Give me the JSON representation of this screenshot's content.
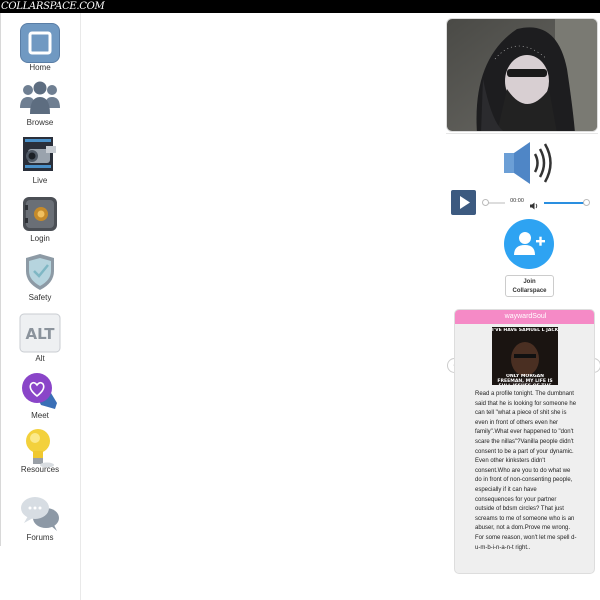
{
  "header": {
    "logo_text": "COLLARSPACE.COM"
  },
  "sidebar": {
    "items": [
      {
        "label": "Home",
        "icon": "home-icon"
      },
      {
        "label": "Browse",
        "icon": "people-icon"
      },
      {
        "label": "Live",
        "icon": "camcorder-icon"
      },
      {
        "label": "Login",
        "icon": "safe-lock-icon"
      },
      {
        "label": "Safety",
        "icon": "shield-icon"
      },
      {
        "label": "Alt",
        "icon": "alt-icon"
      },
      {
        "label": "Meet",
        "icon": "heart-chat-icon"
      },
      {
        "label": "Resources",
        "icon": "lightbulb-icon"
      },
      {
        "label": "Forums",
        "icon": "chat-bubbles-icon"
      }
    ]
  },
  "player": {
    "time": "00:00",
    "volume_percent": 100,
    "progress_percent": 0
  },
  "join": {
    "label": "Join Collarspace"
  },
  "post": {
    "username": "waywardSoul",
    "meme_top": "I'VE HAVE SAMUEL L JACKSON IN MY LIFE",
    "meme_bottom": "ONLY MORGAN FREEMAN, MY LIFE IS FULL ISSUES OF THE WORLD MOTHERF",
    "body": "Read a profile tonight.  The dumbnant said that he is looking for someone he can tell \"what a piece of shit she is even in front of others even her family\".What ever happened to \"don't scare the nillas\"?Vanilla people didn't consent to be a part of your dynamic. Even other kinksters didn't consent.Who are you to do what we do in front of non-consenting people, especially if it can have consequences for your partner outside of bdsm circles? That just screams to me of someone who is an abuser, not a dom.Prove me wrong. For some reason, won't let me spell d-u-m-b-i-n-a-n-t right.."
  },
  "colors": {
    "accent_pink": "#f58ac6",
    "join_blue": "#2ea3f2",
    "player_blue": "#3c5a80"
  }
}
